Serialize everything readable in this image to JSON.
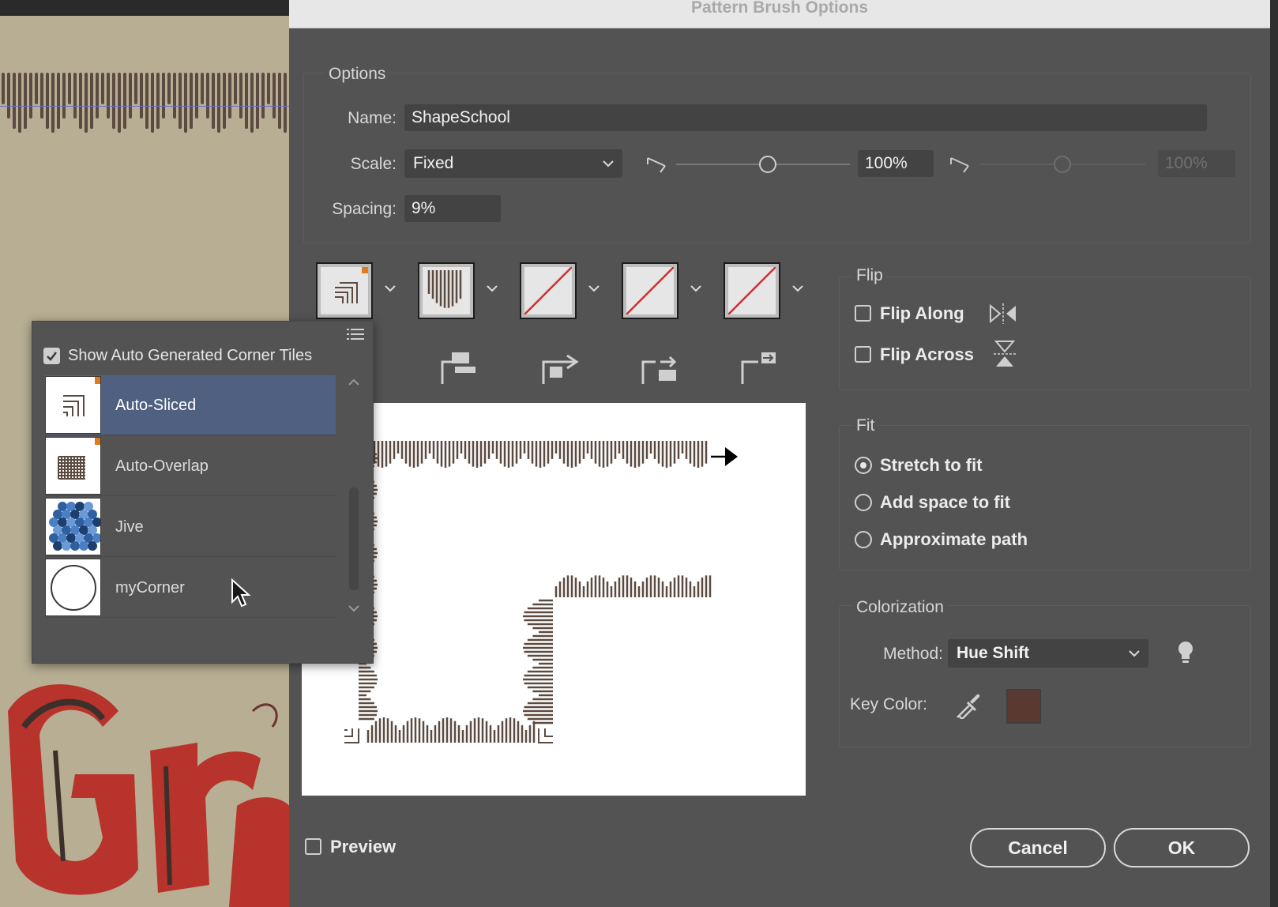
{
  "dialog": {
    "title": "Pattern Brush Options",
    "options": {
      "group_label": "Options",
      "name_label": "Name:",
      "name_value": "ShapeSchool",
      "scale_label": "Scale:",
      "scale_value": "Fixed",
      "scale_percent": "100%",
      "scale_percent_disabled": "100%",
      "scale_slider_level": 0.53,
      "scale_slider_disabled_level": 0.5,
      "spacing_label": "Spacing:",
      "spacing_value": "9%"
    },
    "tiles": [
      {
        "name": "side-tile",
        "icon": "auto-sliced-corner-icon"
      },
      {
        "name": "outer-corner-tile",
        "icon": "side-pattern-icon"
      },
      {
        "name": "inner-corner-tile",
        "icon": "none-tile-icon"
      },
      {
        "name": "start-tile",
        "icon": "none-tile-icon"
      },
      {
        "name": "end-tile",
        "icon": "none-tile-icon"
      }
    ],
    "flip": {
      "group_label": "Flip",
      "flip_along": "Flip Along",
      "flip_along_checked": false,
      "flip_across": "Flip Across",
      "flip_across_checked": false
    },
    "fit": {
      "group_label": "Fit",
      "options": [
        "Stretch to fit",
        "Add space to fit",
        "Approximate path"
      ],
      "selected": "Stretch to fit"
    },
    "colorization": {
      "group_label": "Colorization",
      "method_label": "Method:",
      "method_value": "Hue Shift",
      "key_color_label": "Key Color:",
      "key_color": "#5a3a30"
    },
    "preview_label": "Preview",
    "preview_checked": false,
    "cancel_label": "Cancel",
    "ok_label": "OK"
  },
  "corner_flyout": {
    "show_auto_label": "Show Auto Generated Corner Tiles",
    "show_auto_checked": true,
    "items": [
      {
        "label": "Auto-Sliced",
        "selected": true,
        "icon": "auto-sliced-icon"
      },
      {
        "label": "Auto-Overlap",
        "selected": false,
        "icon": "auto-overlap-icon"
      },
      {
        "label": "Jive",
        "selected": false,
        "icon": "jive-pattern-icon"
      },
      {
        "label": "myCorner",
        "selected": false,
        "icon": "circle-corner-icon"
      }
    ]
  },
  "colors": {
    "dialog_bg": "#535353",
    "selection": "#4f6080",
    "pattern_brown": "#5b4a40",
    "art_red": "#b8332b",
    "art_tan": "#b7ae93"
  }
}
